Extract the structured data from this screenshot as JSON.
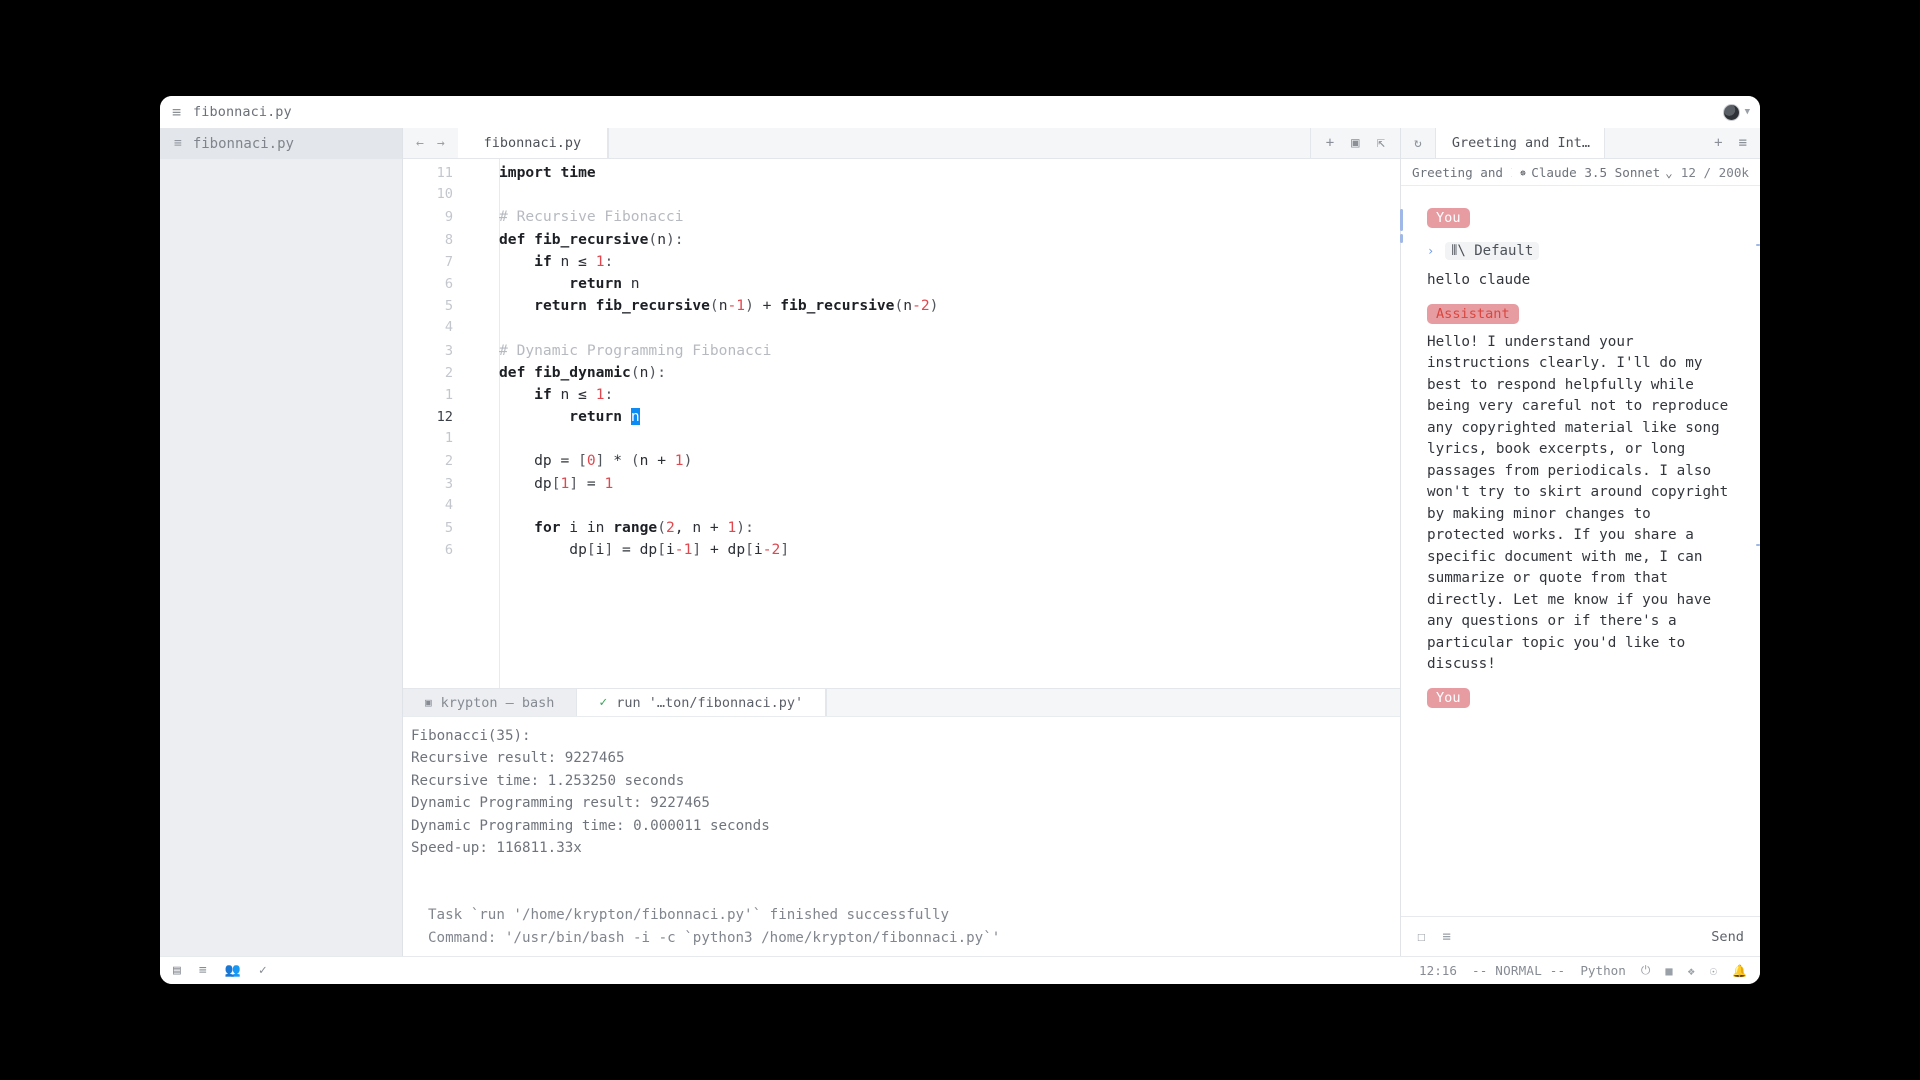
{
  "window": {
    "title": "fibonnaci.py",
    "hamburger_icon": "hamburger-menu-icon",
    "avatar_icon": "user-avatar",
    "chevron_icon": "chevron-down-icon"
  },
  "project_panel": {
    "icon": "project-list-icon",
    "name": "fibonnaci.py"
  },
  "editor": {
    "back_icon": "arrow-left-icon",
    "forward_icon": "arrow-right-icon",
    "tab_label": "fibonnaci.py",
    "actions": {
      "new_icon": "plus-icon",
      "split_icon": "split-pane-icon",
      "expand_icon": "expand-diagonal-icon"
    },
    "lines": [
      {
        "n": "11",
        "current": false,
        "tokens": [
          {
            "t": "import ",
            "c": "kw"
          },
          {
            "t": "time",
            "c": "kw"
          }
        ]
      },
      {
        "n": "10",
        "current": false,
        "tokens": []
      },
      {
        "n": "9",
        "current": false,
        "tokens": [
          {
            "t": "# Recursive Fibonacci",
            "c": "cm"
          }
        ]
      },
      {
        "n": "8",
        "current": false,
        "tokens": [
          {
            "t": "def ",
            "c": "kw"
          },
          {
            "t": "fib_recursive",
            "c": "kw"
          },
          {
            "t": "(",
            "c": "pl"
          },
          {
            "t": "n",
            "c": ""
          },
          {
            "t": "):",
            "c": "pl"
          }
        ]
      },
      {
        "n": "7",
        "current": false,
        "tokens": [
          {
            "t": "    ",
            "c": ""
          },
          {
            "t": "if",
            "c": "kw"
          },
          {
            "t": " n ",
            "c": ""
          },
          {
            "t": "≤",
            "c": ""
          },
          {
            "t": " ",
            "c": ""
          },
          {
            "t": "1",
            "c": "num"
          },
          {
            "t": ":",
            "c": "pl"
          }
        ]
      },
      {
        "n": "6",
        "current": false,
        "tokens": [
          {
            "t": "        ",
            "c": ""
          },
          {
            "t": "return",
            "c": "kw"
          },
          {
            "t": " n",
            "c": ""
          }
        ]
      },
      {
        "n": "5",
        "current": false,
        "tokens": [
          {
            "t": "    ",
            "c": ""
          },
          {
            "t": "return",
            "c": "kw"
          },
          {
            "t": " ",
            "c": ""
          },
          {
            "t": "fib_recursive",
            "c": "kw"
          },
          {
            "t": "(",
            "c": "pl"
          },
          {
            "t": "n",
            "c": ""
          },
          {
            "t": "-",
            "c": "num"
          },
          {
            "t": "1",
            "c": "num"
          },
          {
            "t": ")",
            "c": "pl"
          },
          {
            "t": " + ",
            "c": ""
          },
          {
            "t": "fib_recursive",
            "c": "kw"
          },
          {
            "t": "(",
            "c": "pl"
          },
          {
            "t": "n",
            "c": ""
          },
          {
            "t": "-",
            "c": "num"
          },
          {
            "t": "2",
            "c": "num"
          },
          {
            "t": ")",
            "c": "pl"
          }
        ]
      },
      {
        "n": "4",
        "current": false,
        "tokens": []
      },
      {
        "n": "3",
        "current": false,
        "tokens": [
          {
            "t": "# Dynamic Programming Fibonacci",
            "c": "cm"
          }
        ]
      },
      {
        "n": "2",
        "current": false,
        "tokens": [
          {
            "t": "def ",
            "c": "kw"
          },
          {
            "t": "fib_dynamic",
            "c": "kw"
          },
          {
            "t": "(",
            "c": "pl"
          },
          {
            "t": "n",
            "c": ""
          },
          {
            "t": "):",
            "c": "pl"
          }
        ]
      },
      {
        "n": "1",
        "current": false,
        "tokens": [
          {
            "t": "    ",
            "c": ""
          },
          {
            "t": "if",
            "c": "kw"
          },
          {
            "t": " n ",
            "c": ""
          },
          {
            "t": "≤",
            "c": ""
          },
          {
            "t": " ",
            "c": ""
          },
          {
            "t": "1",
            "c": "num"
          },
          {
            "t": ":",
            "c": "pl"
          }
        ]
      },
      {
        "n": "12",
        "current": true,
        "tokens": [
          {
            "t": "        ",
            "c": ""
          },
          {
            "t": "return",
            "c": "kw"
          },
          {
            "t": " ",
            "c": ""
          },
          {
            "t": "n",
            "c": "cursor"
          }
        ]
      },
      {
        "n": "1",
        "current": false,
        "tokens": []
      },
      {
        "n": "2",
        "current": false,
        "tokens": [
          {
            "t": "    dp = ",
            "c": ""
          },
          {
            "t": "[",
            "c": "pl"
          },
          {
            "t": "0",
            "c": "num"
          },
          {
            "t": "]",
            "c": "pl"
          },
          {
            "t": " * ",
            "c": ""
          },
          {
            "t": "(",
            "c": "pl"
          },
          {
            "t": "n + ",
            "c": ""
          },
          {
            "t": "1",
            "c": "num"
          },
          {
            "t": ")",
            "c": "pl"
          }
        ]
      },
      {
        "n": "3",
        "current": false,
        "tokens": [
          {
            "t": "    dp",
            "c": ""
          },
          {
            "t": "[",
            "c": "pl"
          },
          {
            "t": "1",
            "c": "num"
          },
          {
            "t": "]",
            "c": "pl"
          },
          {
            "t": " = ",
            "c": ""
          },
          {
            "t": "1",
            "c": "num"
          }
        ]
      },
      {
        "n": "4",
        "current": false,
        "tokens": []
      },
      {
        "n": "5",
        "current": false,
        "tokens": [
          {
            "t": "    ",
            "c": ""
          },
          {
            "t": "for",
            "c": "kw"
          },
          {
            "t": " i ",
            "c": ""
          },
          {
            "t": "in",
            "c": ""
          },
          {
            "t": " ",
            "c": ""
          },
          {
            "t": "range",
            "c": "kw"
          },
          {
            "t": "(",
            "c": "pl"
          },
          {
            "t": "2",
            "c": "num"
          },
          {
            "t": ", n + ",
            "c": ""
          },
          {
            "t": "1",
            "c": "num"
          },
          {
            "t": ")",
            "c": "pl"
          },
          {
            "t": ":",
            "c": "pl"
          }
        ]
      },
      {
        "n": "6",
        "current": false,
        "tokens": [
          {
            "t": "        dp",
            "c": ""
          },
          {
            "t": "[",
            "c": "pl"
          },
          {
            "t": "i",
            "c": ""
          },
          {
            "t": "]",
            "c": "pl"
          },
          {
            "t": " = dp",
            "c": ""
          },
          {
            "t": "[",
            "c": "pl"
          },
          {
            "t": "i",
            "c": ""
          },
          {
            "t": "-",
            "c": "num"
          },
          {
            "t": "1",
            "c": "num"
          },
          {
            "t": "]",
            "c": "pl"
          },
          {
            "t": " + dp",
            "c": ""
          },
          {
            "t": "[",
            "c": "pl"
          },
          {
            "t": "i",
            "c": ""
          },
          {
            "t": "-",
            "c": "num"
          },
          {
            "t": "2",
            "c": "num"
          },
          {
            "t": "]",
            "c": "pl"
          }
        ]
      }
    ]
  },
  "terminal": {
    "tabs": [
      {
        "label": "krypton — bash",
        "icon": "terminal-prompt-icon",
        "active": false,
        "check": false
      },
      {
        "label": "run '…ton/fibonnaci.py'",
        "icon": "check-icon",
        "active": true,
        "check": true
      }
    ],
    "output": [
      "Fibonacci(35):",
      "Recursive result: 9227465",
      "Recursive time: 1.253250 seconds",
      "Dynamic Programming result: 9227465",
      "Dynamic Programming time: 0.000011 seconds",
      "Speed-up: 116811.33x"
    ],
    "footer": [
      "Task `run '/home/krypton/fibonnaci.py'` finished successfully",
      "Command: '/usr/bin/bash -i -c `python3 /home/krypton/fibonnaci.py`'"
    ]
  },
  "ai_panel": {
    "history_icon": "history-clock-icon",
    "tab_label": "Greeting and Int…",
    "new_thread_icon": "plus-icon",
    "menu_icon": "hamburger-menu-icon",
    "thread_title": "Greeting and Introd",
    "model_glyph": "anthropic-logo-icon",
    "model_name": "Claude 3.5 Sonnet",
    "model_chevron": "chevron-down-icon",
    "context_usage": "12 / 200k",
    "messages": [
      {
        "role": "You",
        "role_kind": "user",
        "context_label": "Default",
        "context_icon": "profile-bars-icon",
        "caret_icon": "chevron-right-icon",
        "text": "hello claude"
      },
      {
        "role": "Assistant",
        "role_kind": "assistant",
        "text": "Hello! I understand your instructions clearly. I'll do my best to respond helpfully while being very careful not to reproduce any copyrighted material like song lyrics, book excerpts, or long passages from periodicals. I also won't try to skirt around copyright by making minor changes to protected works. If you share a specific document with me, I can summarize or quote from that directly. Let me know if you have any questions or if there's a particular topic you'd like to discuss!"
      },
      {
        "role": "You",
        "role_kind": "user",
        "text": ""
      }
    ],
    "footer": {
      "attach_icon": "file-attach-icon",
      "list_icon": "settings-lines-icon",
      "send_label": "Send"
    }
  },
  "statusbar": {
    "left_icons": [
      "project-panel-icon",
      "outline-panel-icon",
      "collab-panel-icon",
      "diagnostics-check-icon"
    ],
    "time": "12:16",
    "mode": "-- NORMAL --",
    "language": "Python",
    "right_icons": [
      "no-copilot-icon",
      "terminal-icon",
      "extensions-icon",
      "chat-icon",
      "notifications-bell-icon"
    ]
  },
  "colors": {
    "accent_blue": "#0d8bf2",
    "role_badge": "#e79ca1",
    "number_red": "#e0484f",
    "success_green": "#3ea15a"
  }
}
